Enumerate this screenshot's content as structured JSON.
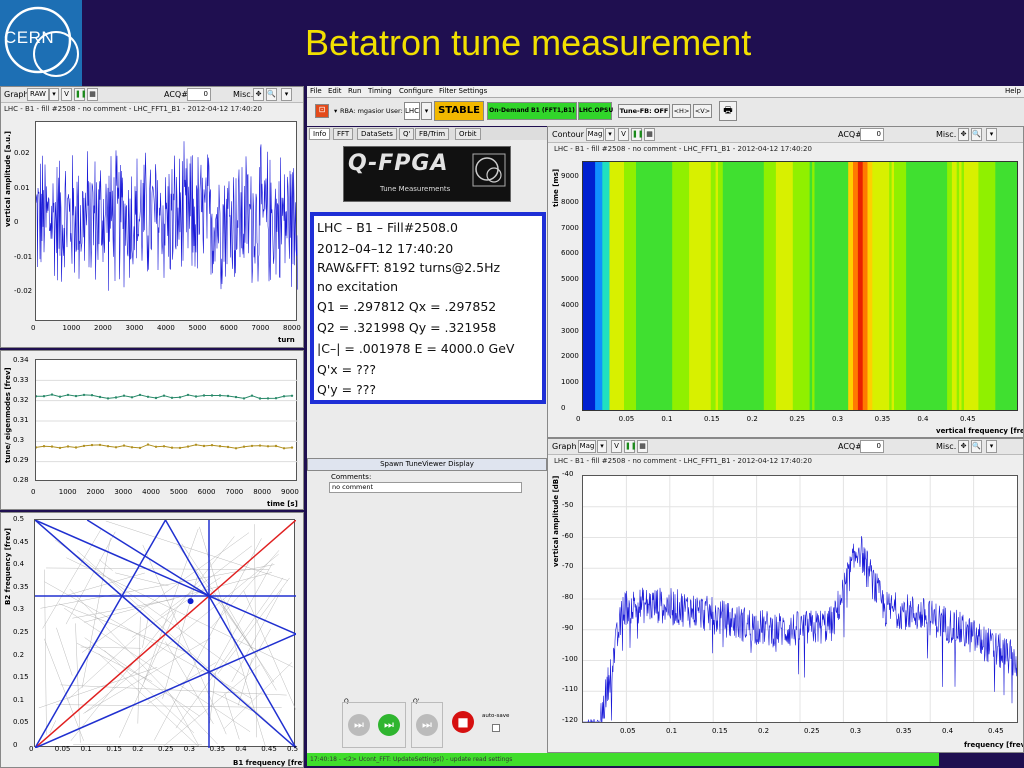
{
  "slide": {
    "title": "Betatron tune measurement",
    "logo_text": "CERN"
  },
  "left_top": {
    "toolbar": {
      "graph": "Graph",
      "mode": "RAW",
      "v": "V",
      "acq": "ACQ#",
      "acq_val": "0",
      "misc": "Misc."
    },
    "caption": "LHC - B1 - fill #2508 - no comment - LHC_FFT1_B1 - 2012-04-12 17:40:20",
    "ylabel": "vertical amplitude [a.u.]",
    "xlabel": "turn",
    "yticks": [
      "0.02",
      "0.01",
      "0",
      "-0.01",
      "-0.02"
    ],
    "xticks": [
      "0",
      "1000",
      "2000",
      "3000",
      "4000",
      "5000",
      "6000",
      "7000",
      "8000"
    ]
  },
  "left_mid": {
    "ylabel": "tune/ eigenmodes [frev]",
    "xlabel": "time [s]",
    "yticks": [
      "0.34",
      "0.33",
      "0.32",
      "0.31",
      "0.3",
      "0.29",
      "0.28"
    ],
    "xticks": [
      "0",
      "1000",
      "2000",
      "3000",
      "4000",
      "5000",
      "6000",
      "7000",
      "8000",
      "9000"
    ]
  },
  "left_bot": {
    "ylabel": "B2 frequency [frev]",
    "xlabel": "B1 frequency [frev]",
    "yticks": [
      "0.5",
      "0.45",
      "0.4",
      "0.35",
      "0.3",
      "0.25",
      "0.2",
      "0.15",
      "0.1",
      "0.05",
      "0"
    ],
    "xticks": [
      "0",
      "0.05",
      "0.1",
      "0.15",
      "0.2",
      "0.25",
      "0.3",
      "0.35",
      "0.4",
      "0.45",
      "0.5"
    ]
  },
  "menu": {
    "file": "File",
    "edit": "Edit",
    "run": "Run",
    "timing": "Timing",
    "configure": "Configure",
    "filter": "Filter Settings",
    "help": "Help"
  },
  "controls": {
    "rba": "RBA: mgasior User:",
    "user": "LHC",
    "stable": "STABLE",
    "ondemand": "On-Demand B1 (FFT1,B1)",
    "lhcopsu": "LHC.OPSU",
    "tunefb": "Tune-FB: OFF",
    "h": "<H>",
    "v": "<V>"
  },
  "tabs": [
    "Info",
    "FFT",
    "DataSets",
    "Q'",
    "FB/Trim",
    "Orbit"
  ],
  "fpga": {
    "title": "Q-FPGA",
    "sub": "Tune Measurements"
  },
  "info": [
    "LHC – B1 – Fill#2508.0",
    "2012–04–12 17:40:20",
    "RAW&FFT: 8192 turns@2.5Hz",
    "no excitation",
    "Q1 =   .297812   Qx = .297852",
    "Q2 =   .321998   Qy = .321958",
    "|C–| = .001978   E =    4000.0 GeV",
    "Q'x =   ???",
    "Q'y =   ???"
  ],
  "spawn": "Spawn TuneViewer Display",
  "comments_label": "Comments:",
  "comments_value": "no comment",
  "bottom_ctrl": {
    "q": "Q",
    "qprime": "Q'",
    "autosave": "auto-save"
  },
  "status": "17:40:18 - <2> Ucont_FFT: UpdateSettings() - update read settings",
  "right_top": {
    "toolbar": {
      "mode": "Contour",
      "mag": "Mag",
      "acq": "ACQ#",
      "acq_val": "0",
      "misc": "Misc."
    },
    "caption": "LHC - B1 - fill #2508 - no comment - LHC_FFT1_B1 - 2012-04-12 17:40:20",
    "ylabel": "time [ms]",
    "xlabel": "vertical frequency [frev]",
    "yticks": [
      "9000",
      "8000",
      "7000",
      "6000",
      "5000",
      "4000",
      "3000",
      "2000",
      "1000",
      "0"
    ],
    "xticks": [
      "0",
      "0.05",
      "0.1",
      "0.15",
      "0.2",
      "0.25",
      "0.3",
      "0.35",
      "0.4",
      "0.45"
    ]
  },
  "right_bot": {
    "toolbar": {
      "mode": "Graph",
      "mag": "Mag",
      "acq": "ACQ#",
      "acq_val": "0",
      "misc": "Misc."
    },
    "caption": "LHC - B1 - fill #2508 - no comment - LHC_FFT1_B1 - 2012-04-12 17:40:20",
    "ylabel": "vertical amplitude [dB]",
    "xlabel": "frequency [frev]",
    "yticks": [
      "-40",
      "-50",
      "-60",
      "-70",
      "-80",
      "-90",
      "-100",
      "-110",
      "-120"
    ],
    "xticks": [
      "0.05",
      "0.1",
      "0.15",
      "0.2",
      "0.25",
      "0.3",
      "0.35",
      "0.4",
      "0.45"
    ]
  },
  "chart_data": [
    {
      "type": "line",
      "xlabel": "turn",
      "ylabel": "vertical amplitude [a.u.]",
      "xlim": [
        0,
        8192
      ],
      "ylim": [
        -0.025,
        0.025
      ],
      "series": [
        {
          "values_desc": "noise ±0.02",
          "amplitude": 0.02
        }
      ]
    },
    {
      "type": "line",
      "xlabel": "time [s]",
      "ylabel": "tune/ eigenmodes [frev]",
      "xlim": [
        0,
        10000
      ],
      "ylim": [
        0.28,
        0.34
      ],
      "series": [
        {
          "y": 0.322
        },
        {
          "y": 0.2975
        }
      ]
    },
    {
      "type": "heatmap",
      "xlabel": "vertical frequency [frev]",
      "ylabel": "time [ms]",
      "xlim": [
        0,
        0.5
      ],
      "ylim": [
        0,
        9500
      ],
      "peak_x": 0.318
    },
    {
      "type": "line",
      "xlabel": "frequency [frev]",
      "ylabel": "vertical amplitude [dB]",
      "xlim": [
        0,
        0.5
      ],
      "ylim": [
        -120,
        -40
      ],
      "peak": {
        "x": 0.318,
        "y": -63
      }
    }
  ]
}
